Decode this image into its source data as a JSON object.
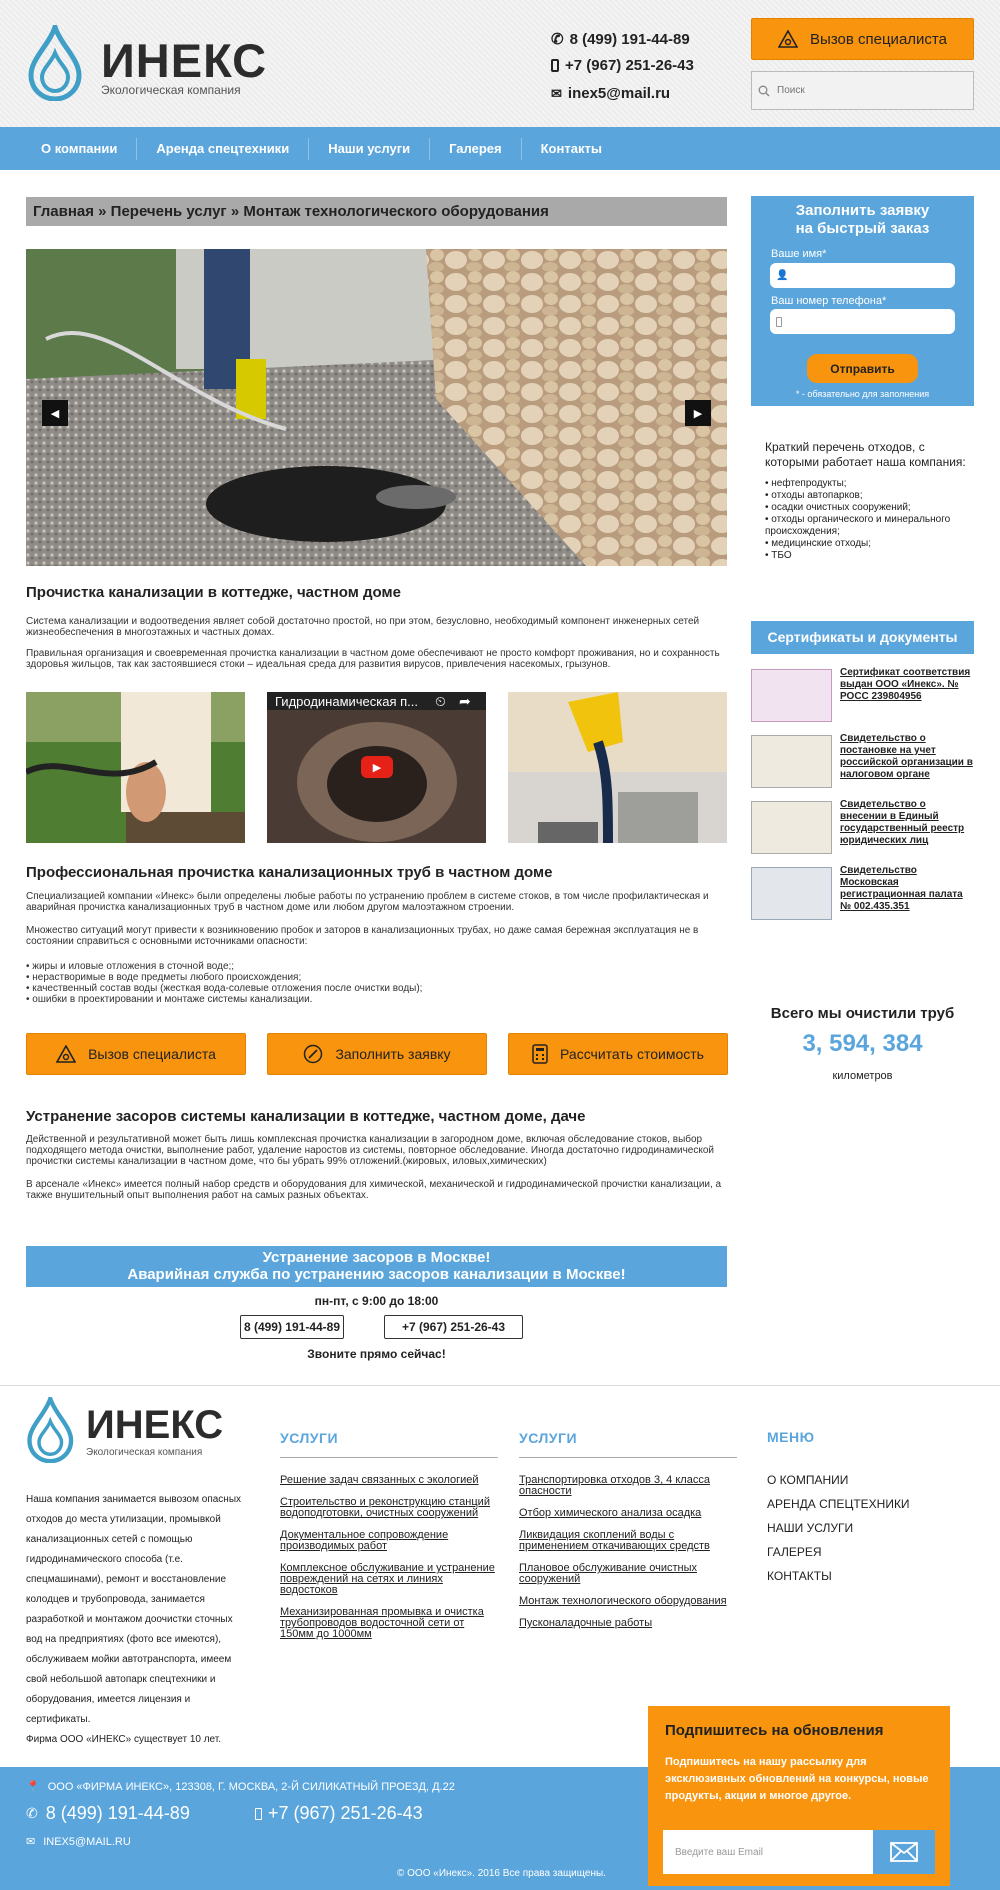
{
  "header": {
    "logo_name": "ИНЕКС",
    "logo_tagline": "Экологическая компания",
    "phone1": "8 (499) 191-44-89",
    "phone2": "+7 (967) 251-26-43",
    "email": "inex5@mail.ru",
    "call_button": "Вызов специалиста",
    "search_placeholder": "Поиск"
  },
  "nav": [
    "О компании",
    "Аренда спецтехники",
    "Наши услуги",
    "Галерея",
    "Контакты"
  ],
  "breadcrumb": "Главная » Перечень услуг » Монтаж технологического оборудования",
  "sections": {
    "s1_title": "Прочистка канализации в коттедже, частном доме",
    "s1_p1": "Система канализации и водоотведения являет собой достаточно простой, но при этом, безусловно, необходимый компонент инженерных сетей жизнеобеспечения в многоэтажных и частных домах.",
    "s1_p2": "Правильная организация и своевременная прочистка канализации в частном доме обеспечивают не просто комфорт проживания, но и сохранность здоровья жильцов, так как застоявшиеся стоки – идеальная среда для развития вирусов, привлечения насекомых, грызунов.",
    "video_title": "Гидродинамическая п...",
    "s2_title": "Профессиональная прочистка канализационных труб в частном доме",
    "s2_p1": "Специализацией компании «Инекс» были определены любые работы по устранению проблем в системе стоков, в том числе профилактическая и аварийная прочистка канализационных труб в частном доме или любом другом малоэтажном строении.",
    "s2_p2": "Множество ситуаций могут привести к возникновению пробок и заторов в канализационных трубах, но даже самая бережная эксплуатация не в состоянии справиться с основными источниками опасности:",
    "s2_bullets": [
      "• жиры и иловые отложения в сточной воде;;",
      "• нерастворимые в воде предметы любого происхождения;",
      "• качественный состав воды (жесткая вода-солевые отложения после очистки воды);",
      "• ошибки в проектировании и монтаже системы канализации."
    ],
    "s3_title": "Устранение засоров системы канализации в коттедже, частном доме, даче",
    "s3_p1": "Действенной и результативной может быть лишь комплексная прочистка канализации в загородном доме, включая обследование стоков, выбор подходящего метода очистки, выполнение работ, удаление наростов из системы, повторное обследование. Иногда достаточно гидродинамической прочистки системы канализации в частном доме, что бы убрать 99% отложений.(жировых, иловых,химических)",
    "s3_p2": "В арсенале «Инекс» имеется полный набор средств и оборудования для химической, механической и гидродинамической прочистки канализации, а также внушительный опыт выполнения работ на самых разных объектах."
  },
  "buttons": {
    "call": "Вызов специалиста",
    "fill": "Заполнить заявку",
    "calc": "Рассчитать стоимость"
  },
  "emergency": {
    "line1": "Устранение засоров в Москве!",
    "line2": "Аварийная служба по устранению засоров канализации в Москве!",
    "hours": "пн-пт, с 9:00 до 18:00",
    "phone1": "8 (499) 191-44-89",
    "phone2": "+7 (967) 251-26-43",
    "call_now": "Звоните прямо сейчас!"
  },
  "sidebar": {
    "form_title_1": "Заполнить заявку",
    "form_title_2": "на быстрый заказ",
    "name_label": "Ваше имя*",
    "phone_label": "Ваш номер телефона*",
    "send": "Отправить",
    "required_note": "* - обязательно для заполнения",
    "waste_intro": "Краткий перечень отходов, с которыми работает наша компания:",
    "waste_items": [
      "• нефтепродукты;",
      "• отходы автопарков;",
      "• осадки очистных сооружений;",
      "• отходы органического и минерального происхождения;",
      "• медицинские отходы;",
      "• ТБО"
    ],
    "cert_title": "Сертификаты и документы",
    "certs": [
      "Сертификат соответствия выдан ООО «Инекс». № РОСС 239804956",
      "Свидетельство о постановке на учет российской организации в налоговом органе",
      "Свидетельство о внесении в Единый государственный реестр юридических лиц",
      "Свидетельство Московская регистрационная палата № 002.435.351"
    ],
    "total_title": "Всего мы очистили труб",
    "total_value": "3, 594, 384",
    "total_unit": "километров"
  },
  "footer": {
    "logo_name": "ИНЕКС",
    "logo_tagline": "Экологическая компания",
    "about": "Наша компания занимается вывозом опасных отходов до места утилизации, промывкой канализационных сетей с помощью гидродинамического способа (т.е. спецмашинами), ремонт и восстановление колодцев и трубопровода, занимается разработкой и монтажом доочистки сточных вод на предприятиях (фото все имеются), обслуживаем мойки автотранспорта, имеем свой небольшой автопарк спецтехники и оборудования, имеется лицензия и сертификаты.",
    "since": "Фирма ООО «ИНЕКС» существует 10 лет.",
    "col1_title": "УСЛУГИ",
    "col1_links": [
      "Решение задач связанных с экологией",
      "Строительство и реконструкцию станций водоподготовки, очистных сооружений",
      "Документальное сопровождение производимых работ",
      "Комплексное обслуживание и устранение повреждений на сетях и линиях водостоков",
      "Механизированная промывка и очистка трубопроводов водосточной сети от 150мм до 1000мм"
    ],
    "col2_title": "УСЛУГИ",
    "col2_links": [
      "Транспортировка отходов 3, 4 класса опасности",
      "Отбор химического анализа осадка",
      "Ликвидация скоплений воды с применением откачивающих средств",
      "Плановое обслуживание очистных сооружений",
      "Монтаж технологического оборудования",
      "Пусконаладочные работы"
    ],
    "menu_title": "МЕНЮ",
    "menu": [
      "О КОМПАНИИ",
      "АРЕНДА СПЕЦТЕХНИКИ",
      "НАШИ УСЛУГИ",
      "ГАЛЕРЕЯ",
      "КОНТАКТЫ"
    ],
    "address": "ООО «ФИРМА ИНЕКС», 123308, Г. МОСКВА, 2-Й СИЛИКАТНЫЙ ПРОЕЗД, Д.22",
    "phone1": "8 (499) 191-44-89",
    "phone2": "+7 (967) 251-26-43",
    "email": "INEX5@MAIL.RU",
    "copyright": "© ООО «Инекс». 2016 Все права защищены."
  },
  "subscribe": {
    "title": "Подпишитесь на обновления",
    "text": "Подпишитесь на нашу рассылку для эксклюзивных обновлений на конкурсы, новые продукты, акции и многое другое.",
    "placeholder": "Введите ваш Email"
  },
  "colors": {
    "accent_blue": "#5ba5dd",
    "accent_orange": "#f8940e"
  }
}
